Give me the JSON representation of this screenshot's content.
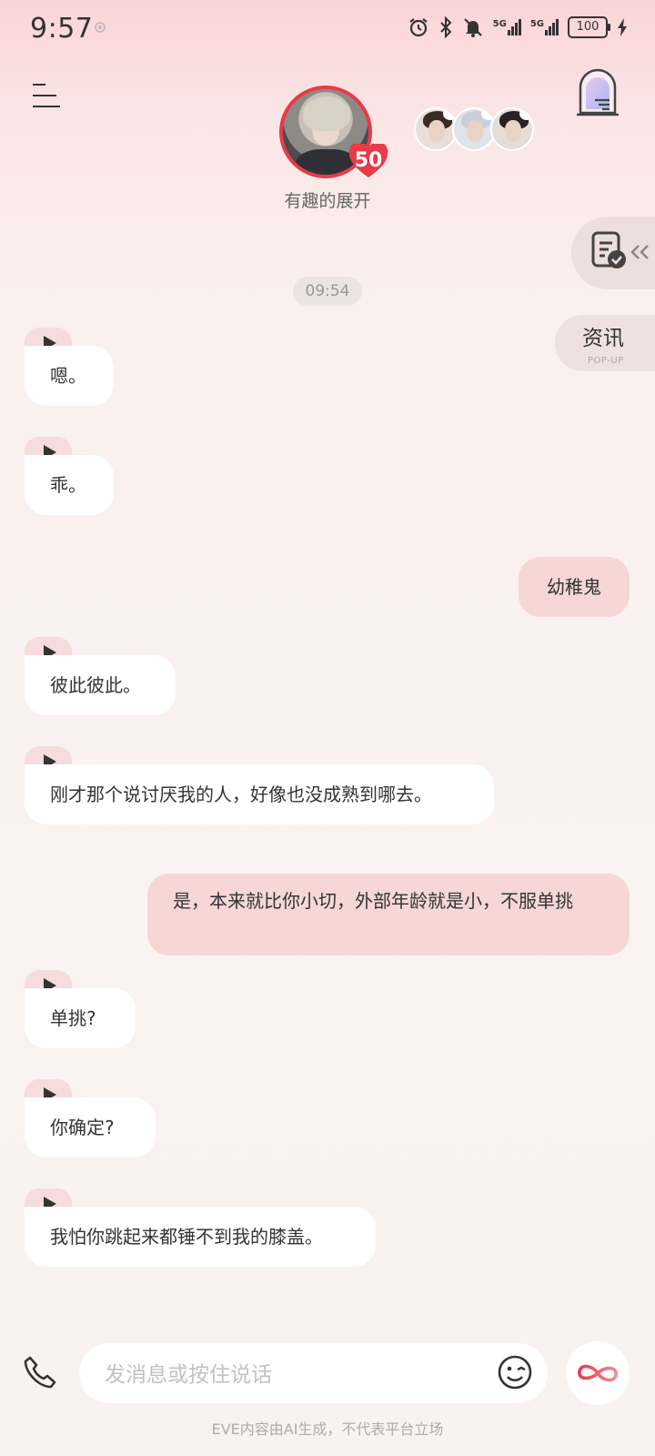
{
  "status_bar": {
    "time": "9:57",
    "signal_1": "5G",
    "signal_2": "5G",
    "battery": "100"
  },
  "header": {
    "scene_title": "有趣的展开",
    "level": "50",
    "icons": [
      "menu-icon",
      "portal-icon",
      "document-check-icon"
    ]
  },
  "side": {
    "news_label": "资讯",
    "news_sub": "POP-UP"
  },
  "chat": {
    "timestamp": "09:54",
    "messages": [
      {
        "side": "left",
        "text": "嗯。"
      },
      {
        "side": "left",
        "text": "乖。"
      },
      {
        "side": "right",
        "text": "幼稚鬼"
      },
      {
        "side": "left",
        "text": "彼此彼此。"
      },
      {
        "side": "left",
        "text": "刚才那个说讨厌我的人，好像也没成熟到哪去。"
      },
      {
        "side": "right",
        "text": "是，本来就比你小切，外部年龄就是小，不服单挑"
      },
      {
        "side": "left",
        "text": "单挑?"
      },
      {
        "side": "left",
        "text": "你确定?"
      },
      {
        "side": "left",
        "text": "我怕你跳起来都锤不到我的膝盖。"
      }
    ]
  },
  "input": {
    "placeholder": "发消息或按住说话"
  },
  "footer": {
    "disclaimer": "EVE内容由AI生成，不代表平台立场"
  },
  "colors": {
    "accent": "#e83a48",
    "bubble_user": "#f6d7d6",
    "bubble_bot": "#ffffff",
    "play_tab": "#f6dcdc"
  }
}
